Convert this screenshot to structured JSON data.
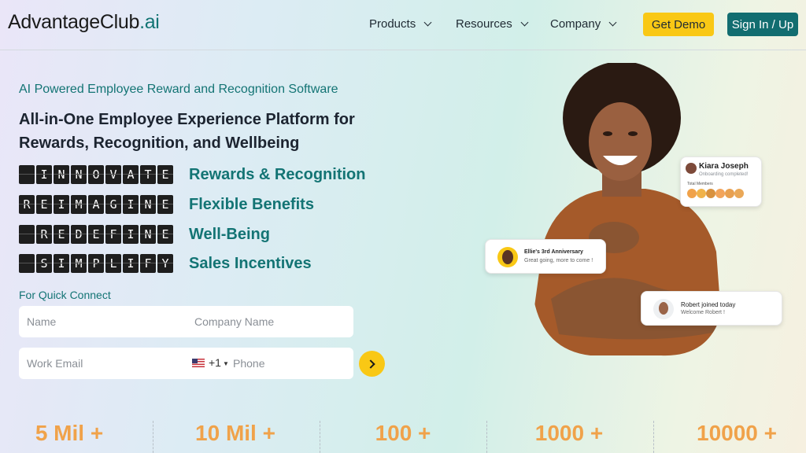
{
  "header": {
    "logo_main": "AdvantageClub",
    "logo_suffix": ".ai",
    "nav": [
      "Products",
      "Resources",
      "Company"
    ],
    "get_demo": "Get Demo",
    "sign_in": "Sign In / Up"
  },
  "hero": {
    "subtitle": "AI Powered Employee Reward and Recognition Software",
    "headline": "All-in-One Employee Experience Platform for Rewards, Recognition, and Wellbeing",
    "features": [
      {
        "word": " INNOVATE",
        "label": "Rewards & Recognition"
      },
      {
        "word": "REIMAGINE",
        "label": "Flexible Benefits"
      },
      {
        "word": " REDEFINE",
        "label": "Well-Being"
      },
      {
        "word": " SIMPLIFY",
        "label": "Sales Incentives"
      }
    ]
  },
  "form": {
    "title": "For Quick Connect",
    "name_placeholder": "Name",
    "company_placeholder": "Company Name",
    "email_placeholder": "Work Email",
    "dial_code": "+1",
    "phone_placeholder": "Phone"
  },
  "stats": [
    "5 Mil +",
    "10 Mil +",
    "100 +",
    "1000 +",
    "10000 +"
  ],
  "cards": {
    "kiara_name": "Kiara  Joseph",
    "kiara_status": "Onboarding completed!",
    "kiara_members_label": "Total Members",
    "ellie_title": "Ellie's 3rd Anniversary",
    "ellie_sub": "Great going, more to come !",
    "robert_title": "Robert joined today",
    "robert_sub": "Welcome Robert !"
  },
  "colors": {
    "brand_teal": "#137474",
    "accent_yellow": "#f9c815",
    "stat_orange": "#f0a24a"
  }
}
